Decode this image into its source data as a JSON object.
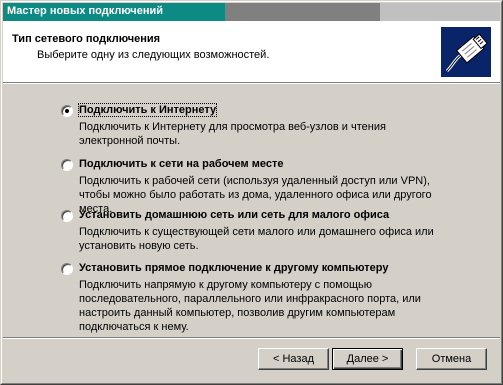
{
  "window": {
    "title": "Мастер новых подключений"
  },
  "header": {
    "title": "Тип сетевого подключения",
    "subtitle": "Выберите одну из следующих возможностей.",
    "icon": "network-cable-icon"
  },
  "options": [
    {
      "label": "Подключить к Интернету",
      "description": "Подключить к Интернету для просмотра веб-узлов и чтения  электронной почты.",
      "selected": true
    },
    {
      "label": "Подключить к сети на рабочем месте",
      "description": "Подключить к рабочей сети (используя удаленный доступ или VPN), чтобы можно было работать из дома, удаленного офиса или другого места.",
      "selected": false
    },
    {
      "label": "Установить домашнюю сеть или сеть для малого офиса",
      "description": "Подключить к существующей сети малого или домашнего офиса или установить новую сеть.",
      "selected": false
    },
    {
      "label": "Установить прямое подключение к другому компьютеру",
      "description": "Подключить напрямую к другому компьютеру с помощью последовательного, параллельного или инфракрасного порта, или настроить данный компьютер, позволив другим  компьютерам подключаться к нему.",
      "selected": false
    }
  ],
  "buttons": {
    "back": "< Назад",
    "next": "Далее >",
    "cancel": "Отмена"
  },
  "colors": {
    "header_icon_bg": "#0a246a",
    "dialog_face": "#d4d0c8"
  }
}
